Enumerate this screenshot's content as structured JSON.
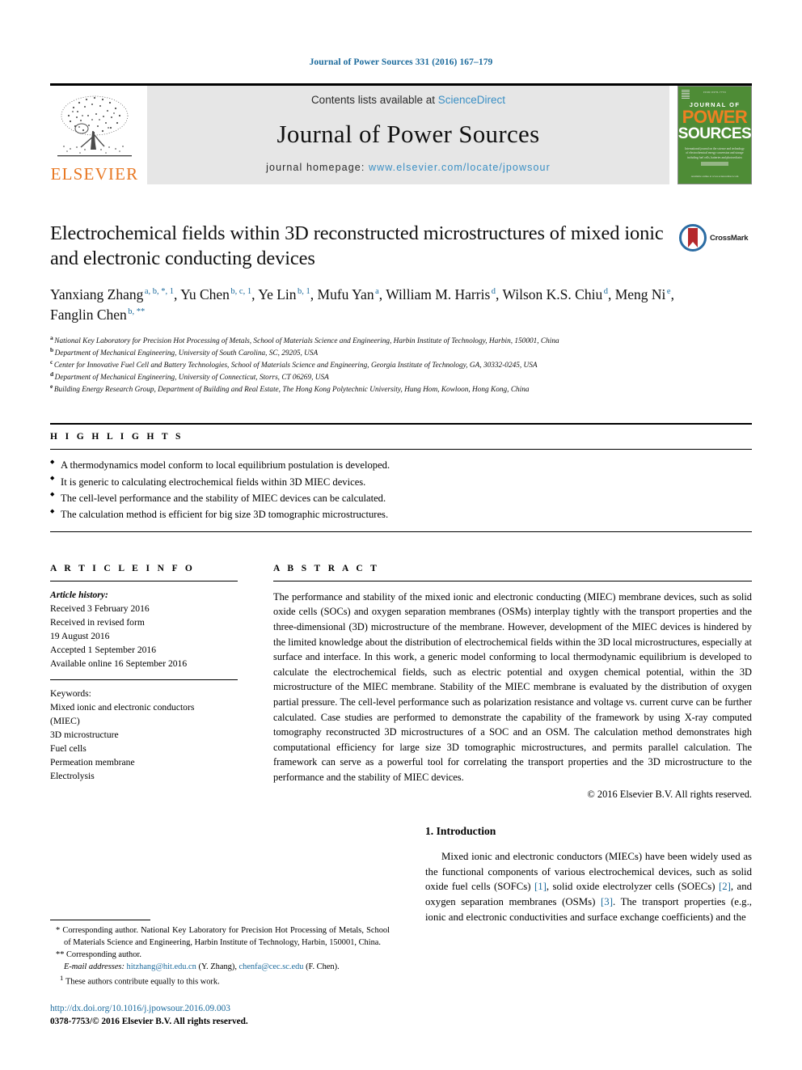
{
  "running_head": "Journal of Power Sources 331 (2016) 167–179",
  "masthead": {
    "elsevier_wordmark": "ELSEVIER",
    "contents_prefix": "Contents lists available at ",
    "sciencedirect": "ScienceDirect",
    "journal_name": "Journal of Power Sources",
    "homepage_prefix": "journal homepage: ",
    "homepage_url": "www.elsevier.com/locate/jpowsour",
    "cover": {
      "top_label": "ISSN 0378-7753",
      "journal_of": "JOURNAL OF",
      "power": "POWER",
      "sources": "SOURCES",
      "tagline": "International journal on the science and technology of electrochemical energy conversion and storage including fuel cells, batteries and photovoltaics",
      "footer": "Available online at www.sciencedirect.com"
    }
  },
  "article": {
    "title": "Electrochemical fields within 3D reconstructed microstructures of mixed ionic and electronic conducting devices",
    "crossmark_label": "CrossMark",
    "authors": [
      {
        "name": "Yanxiang Zhang",
        "sup": "a, b, *, 1",
        "sep": ", "
      },
      {
        "name": "Yu Chen",
        "sup": "b, c, 1",
        "sep": ", "
      },
      {
        "name": "Ye Lin",
        "sup": "b, 1",
        "sep": ", "
      },
      {
        "name": "Mufu Yan",
        "sup": "a",
        "sep": ", "
      },
      {
        "name": "William M. Harris",
        "sup": "d",
        "sep": ", "
      },
      {
        "name": "Wilson K.S. Chiu",
        "sup": "d",
        "sep": ", "
      },
      {
        "name": "Meng Ni",
        "sup": "e",
        "sep": ", "
      },
      {
        "name": "Fanglin Chen",
        "sup": "b, **",
        "sep": ""
      }
    ],
    "affiliations": [
      {
        "mark": "a",
        "text": "National Key Laboratory for Precision Hot Processing of Metals, School of Materials Science and Engineering, Harbin Institute of Technology, Harbin, 150001, China"
      },
      {
        "mark": "b",
        "text": "Department of Mechanical Engineering, University of South Carolina, SC, 29205, USA"
      },
      {
        "mark": "c",
        "text": "Center for Innovative Fuel Cell and Battery Technologies, School of Materials Science and Engineering, Georgia Institute of Technology, GA, 30332-0245, USA"
      },
      {
        "mark": "d",
        "text": "Department of Mechanical Engineering, University of Connecticut, Storrs, CT 06269, USA"
      },
      {
        "mark": "e",
        "text": "Building Energy Research Group, Department of Building and Real Estate, The Hong Kong Polytechnic University, Hung Hom, Kowloon, Hong Kong, China"
      }
    ]
  },
  "highlights": {
    "heading": "H I G H L I G H T S",
    "items": [
      "A thermodynamics model conform to local equilibrium postulation is developed.",
      "It is generic to calculating electrochemical fields within 3D MIEC devices.",
      "The cell-level performance and the stability of MIEC devices can be calculated.",
      "The calculation method is efficient for big size 3D tomographic microstructures."
    ]
  },
  "article_info": {
    "heading": "A R T I C L E  I N F O",
    "history_label": "Article history:",
    "history": [
      "Received 3 February 2016",
      "Received in revised form",
      "19 August 2016",
      "Accepted 1 September 2016",
      "Available online 16 September 2016"
    ],
    "keywords_label": "Keywords:",
    "keywords": [
      "Mixed ionic and electronic conductors",
      "(MIEC)",
      "3D microstructure",
      "Fuel cells",
      "Permeation membrane",
      "Electrolysis"
    ]
  },
  "abstract": {
    "heading": "A B S T R A C T",
    "text": "The performance and stability of the mixed ionic and electronic conducting (MIEC) membrane devices, such as solid oxide cells (SOCs) and oxygen separation membranes (OSMs) interplay tightly with the transport properties and the three-dimensional (3D) microstructure of the membrane. However, development of the MIEC devices is hindered by the limited knowledge about the distribution of electrochemical fields within the 3D local microstructures, especially at surface and interface. In this work, a generic model conforming to local thermodynamic equilibrium is developed to calculate the electrochemical fields, such as electric potential and oxygen chemical potential, within the 3D microstructure of the MIEC membrane. Stability of the MIEC membrane is evaluated by the distribution of oxygen partial pressure. The cell-level performance such as polarization resistance and voltage vs. current curve can be further calculated. Case studies are performed to demonstrate the capability of the framework by using X-ray computed tomography reconstructed 3D microstructures of a SOC and an OSM. The calculation method demonstrates high computational efficiency for large size 3D tomographic microstructures, and permits parallel calculation. The framework can serve as a powerful tool for correlating the transport properties and the 3D microstructure to the performance and the stability of MIEC devices.",
    "copyright": "© 2016 Elsevier B.V. All rights reserved."
  },
  "introduction": {
    "heading": "1. Introduction",
    "paragraph_part1": "Mixed ionic and electronic conductors (MIECs) have been widely used as the functional components of various electrochemical devices, such as solid oxide fuel cells (SOFCs) ",
    "cite1": "[1]",
    "paragraph_part2": ", solid oxide electrolyzer cells (SOECs) ",
    "cite2": "[2]",
    "paragraph_part3": ", and oxygen separation membranes (OSMs) ",
    "cite3": "[3]",
    "paragraph_part4": ". The transport properties (e.g., ionic and electronic conductivities and surface exchange coefficients) and the"
  },
  "footnotes": {
    "corresponding_1_mark": "*",
    "corresponding_1": "Corresponding author. National Key Laboratory for Precision Hot Processing of Metals, School of Materials Science and Engineering, Harbin Institute of Technology, Harbin, 150001, China.",
    "corresponding_2_mark": "**",
    "corresponding_2": "Corresponding author.",
    "email_label": "E-mail addresses:",
    "email_1": "hitzhang@hit.edu.cn",
    "email_1_owner": "(Y. Zhang)",
    "email_2": "chenfa@cec.sc.edu",
    "email_2_owner": "(F. Chen).",
    "equal_mark": "1",
    "equal_contribution": "These authors contribute equally to this work."
  },
  "footer": {
    "doi": "http://dx.doi.org/10.1016/j.jpowsour.2016.09.003",
    "issn_line": "0378-7753/© 2016 Elsevier B.V. All rights reserved."
  },
  "colors": {
    "link_blue": "#1b6a9c",
    "light_blue": "#3a8fc4",
    "elsevier_orange": "#E87722",
    "cover_green": "#4e8c36",
    "crossmark_red": "#b5292c"
  }
}
